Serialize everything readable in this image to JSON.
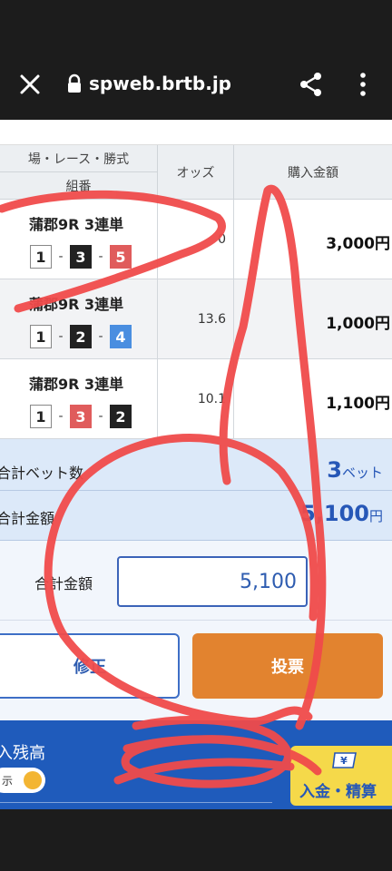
{
  "browser": {
    "url": "spweb.brtb.jp",
    "icons": [
      "close-icon",
      "lock-icon",
      "share-icon",
      "more-vert-icon"
    ]
  },
  "table": {
    "header_top": "場・レース・勝式",
    "header_bottom": "組番",
    "header_odds": "オッズ",
    "header_amount": "購入金額",
    "rows": [
      {
        "race": "蒲郡9R 3連単",
        "combo": [
          "1",
          "3",
          "5"
        ],
        "odds": "0",
        "amount": "3,000円"
      },
      {
        "race": "蒲郡9R 3連単",
        "combo": [
          "1",
          "2",
          "4"
        ],
        "odds": "13.6",
        "amount": "1,000円"
      },
      {
        "race": "蒲郡9R 3連単",
        "combo": [
          "1",
          "3",
          "2"
        ],
        "odds": "10.1",
        "amount": "1,100円"
      }
    ],
    "dash": "-"
  },
  "summary": {
    "bets_label": "合計ベット数",
    "bets_value": "3",
    "bets_unit": "ベット",
    "amount_label": "合計金額",
    "amount_value": "5,100",
    "amount_unit": "円"
  },
  "total": {
    "label": "合計金額",
    "input_value": "5,100"
  },
  "buttons": {
    "edit": "修正",
    "vote": "投票"
  },
  "footer": {
    "balance_label": "入残高",
    "toggle_label": "示",
    "deposit_label": "入金・精算",
    "deposit_icon_text": "¥"
  },
  "colors": {
    "accent_blue": "#1f5bbb",
    "vote_orange": "#e2832f",
    "deposit_yellow": "#f5d94a",
    "scribble_red": "#f04b4b"
  }
}
